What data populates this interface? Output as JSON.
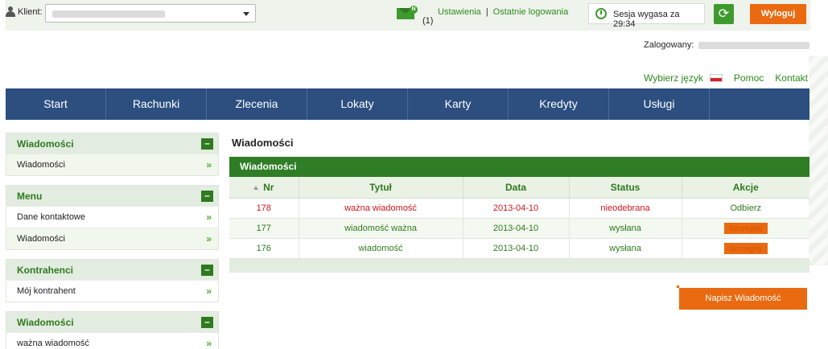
{
  "header": {
    "client_label": "Klient:",
    "mail_badge": "N",
    "mail_count": "(1)",
    "links": {
      "settings": "Ustawienia",
      "separator": "|",
      "last_logins": "Ostatnie logowania"
    },
    "session_text": "Sesja wygasa za 29:34",
    "logout_label": "Wyloguj",
    "logged_in_label": "Zalogowany:"
  },
  "util": {
    "language": "Wybierz język",
    "help": "Pomoc",
    "contact": "Kontakt"
  },
  "nav": {
    "items": [
      "Start",
      "Rachunki",
      "Zlecenia",
      "Lokaty",
      "Karty",
      "Kredyty",
      "Usługi"
    ]
  },
  "sidebar": {
    "groups": [
      {
        "title": "Wiadomości",
        "items": [
          "Wiadomości"
        ]
      },
      {
        "title": "Menu",
        "items": [
          "Dane kontaktowe",
          "Wiadomości"
        ]
      },
      {
        "title": "Kontrahenci",
        "items": [
          "Mój kontrahent"
        ]
      },
      {
        "title": "Wiadomości",
        "items": [
          "ważna wiadomość"
        ]
      }
    ],
    "arrow": "»",
    "collapse": "–"
  },
  "main": {
    "title": "Wiadomości",
    "panel_title": "Wiadomości",
    "columns": [
      "Nr",
      "Tytuł",
      "Data",
      "Status",
      "Akcje"
    ],
    "rows": [
      {
        "nr": "178",
        "title": "ważna wiadomość",
        "date": "2013-04-10",
        "status": "nieodebrana",
        "action": "Odbierz"
      },
      {
        "nr": "177",
        "title": "wiadomość ważna",
        "date": "2013-04-10",
        "status": "wysłana",
        "action": "Szczegóły"
      },
      {
        "nr": "176",
        "title": "wiadomość",
        "date": "2013-04-10",
        "status": "wysłana",
        "action": "Szczegóły"
      }
    ],
    "write_button": "Napisz Wiadomość"
  },
  "colors": {
    "brand_green": "#2f7d24",
    "nav_blue": "#2c4f80",
    "accent_orange": "#e96a10",
    "unread_red": "#d0141c"
  }
}
